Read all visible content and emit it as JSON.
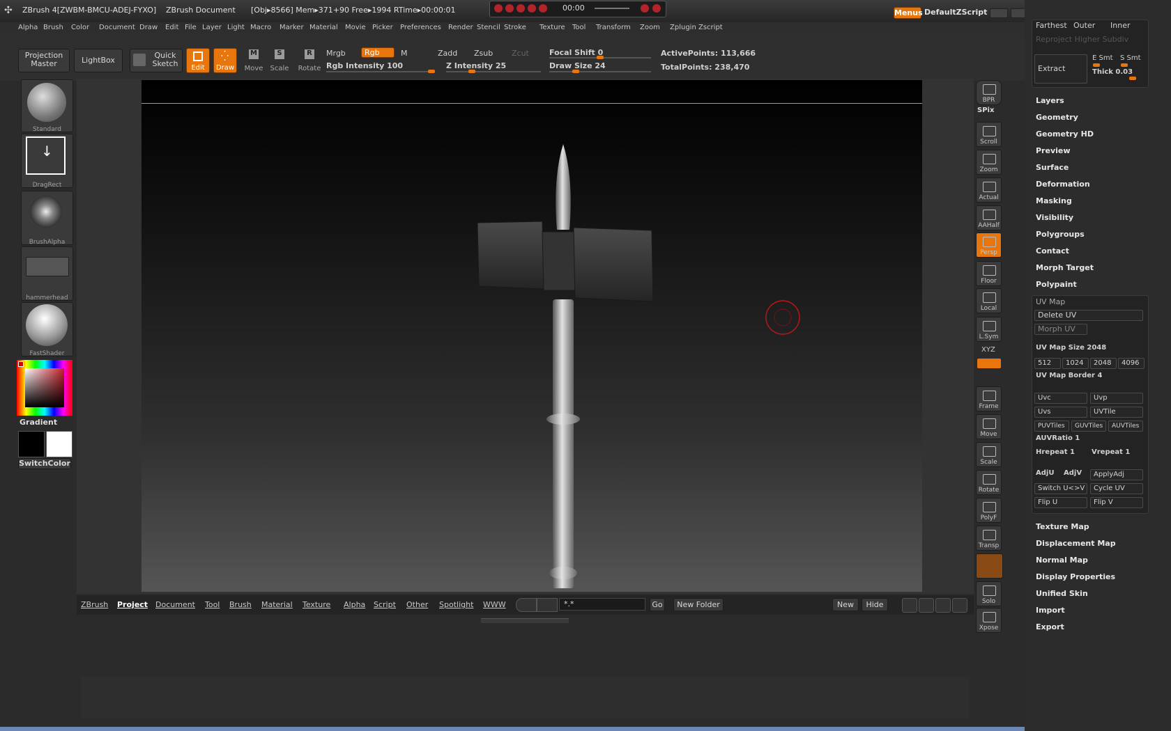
{
  "title": {
    "app": "ZBrush 4[ZWBM-BMCU-ADEJ-FYXO]",
    "document": "ZBrush Document",
    "stats": "[Obj▸8566] Mem▸371+90 Free▸1994 RTime▸00:00:01",
    "timer": "00:00",
    "menus_label": "Menus",
    "script_label": "DefaultZScript"
  },
  "menubar": [
    "Alpha",
    "Brush",
    "Color",
    "Document",
    "Draw",
    "Edit",
    "File",
    "Layer",
    "Light",
    "Macro",
    "Marker",
    "Material",
    "Movie",
    "Picker",
    "Preferences",
    "Render",
    "Stencil",
    "Stroke",
    "Texture",
    "Tool",
    "Transform",
    "Zoom",
    "Zplugin",
    "Zscript"
  ],
  "toolbar": {
    "projection_master": "Projection Master",
    "lightbox": "LightBox",
    "quick_sketch": "Quick Sketch",
    "edit": "Edit",
    "draw": "Draw",
    "move": "Move",
    "scale": "Scale",
    "rotate": "Rotate",
    "mrgb": "Mrgb",
    "rgb": "Rgb",
    "m": "M",
    "zadd": "Zadd",
    "zsub": "Zsub",
    "zcut": "Zcut",
    "rgb_intensity": "Rgb Intensity 100",
    "z_intensity": "Z Intensity 25",
    "focal_shift": "Focal Shift 0",
    "draw_size": "Draw Size 24",
    "active_points": "ActivePoints: 113,666",
    "total_points": "TotalPoints: 238,470"
  },
  "sliders": {
    "rgb_intensity": 100,
    "z_intensity": 25,
    "focal_shift": 0,
    "draw_size": 24
  },
  "lefttray": {
    "standard": "Standard",
    "dragrect": "DragRect",
    "brushalpha": "BrushAlpha",
    "hammerhead": "hammerhead",
    "fastshader": "FastShader",
    "gradient": "Gradient",
    "switchcolor": "SwitchColor"
  },
  "rightshelf": [
    "BPR",
    "SPix",
    "Scroll",
    "Zoom",
    "Actual",
    "AAHalf",
    "Persp",
    "Floor",
    "Local",
    "L.Sym",
    "XYZ",
    "Frame",
    "Move",
    "Scale",
    "Rotate",
    "PolyF",
    "Transp",
    "Solo",
    "Xpose"
  ],
  "rightpanel": {
    "farthest": "Farthest",
    "outer": "Outer",
    "inner": "Inner",
    "reproject": "Reproject Higher Subdiv",
    "extract": "Extract",
    "e_smt": "E Smt",
    "s_smt": "S Smt",
    "thick": "Thick 0.03",
    "menu_items_top": [
      "Layers",
      "Geometry",
      "Geometry HD",
      "Preview",
      "Surface",
      "Deformation",
      "Masking",
      "Visibility",
      "Polygroups",
      "Contact",
      "Morph Target",
      "Polypaint"
    ],
    "uvmap_title": "UV Map",
    "delete_uv": "Delete UV",
    "morph_uv": "Morph UV",
    "uv_map_size": "UV Map Size 2048",
    "sizes": [
      "512",
      "1024",
      "2048",
      "4096"
    ],
    "uv_map_border": "UV Map Border 4",
    "uvc": "Uvc",
    "uvp": "Uvp",
    "uvs": "Uvs",
    "uvtile": "UVTile",
    "puvtiles": "PUVTiles",
    "guvtiles": "GUVTiles",
    "auvtiles": "AUVTiles",
    "auvratio": "AUVRatio 1",
    "hrepeat": "Hrepeat 1",
    "vrepeat": "Vrepeat 1",
    "adju": "AdjU",
    "adjv": "AdjV",
    "applyadj": "ApplyAdj",
    "switch_uv": "Switch U<>V",
    "cycle_uv": "Cycle UV",
    "flip_u": "Flip U",
    "flip_v": "Flip V",
    "menu_items_bottom": [
      "Texture Map",
      "Displacement Map",
      "Normal Map",
      "Display Properties",
      "Unified Skin",
      "Import",
      "Export"
    ]
  },
  "bottombar": {
    "tabs": [
      "ZBrush",
      "Project",
      "Document",
      "Tool",
      "Brush",
      "Material",
      "Texture",
      "Alpha",
      "Script",
      "Other",
      "Spotlight",
      "WWW"
    ],
    "search_value": "*.*",
    "go": "Go",
    "new_folder": "New Folder",
    "new": "New",
    "hide": "Hide"
  },
  "colors": {
    "accent": "#e9760d",
    "panel": "#2c2c2c",
    "brush_cursor": "#c0161a"
  }
}
